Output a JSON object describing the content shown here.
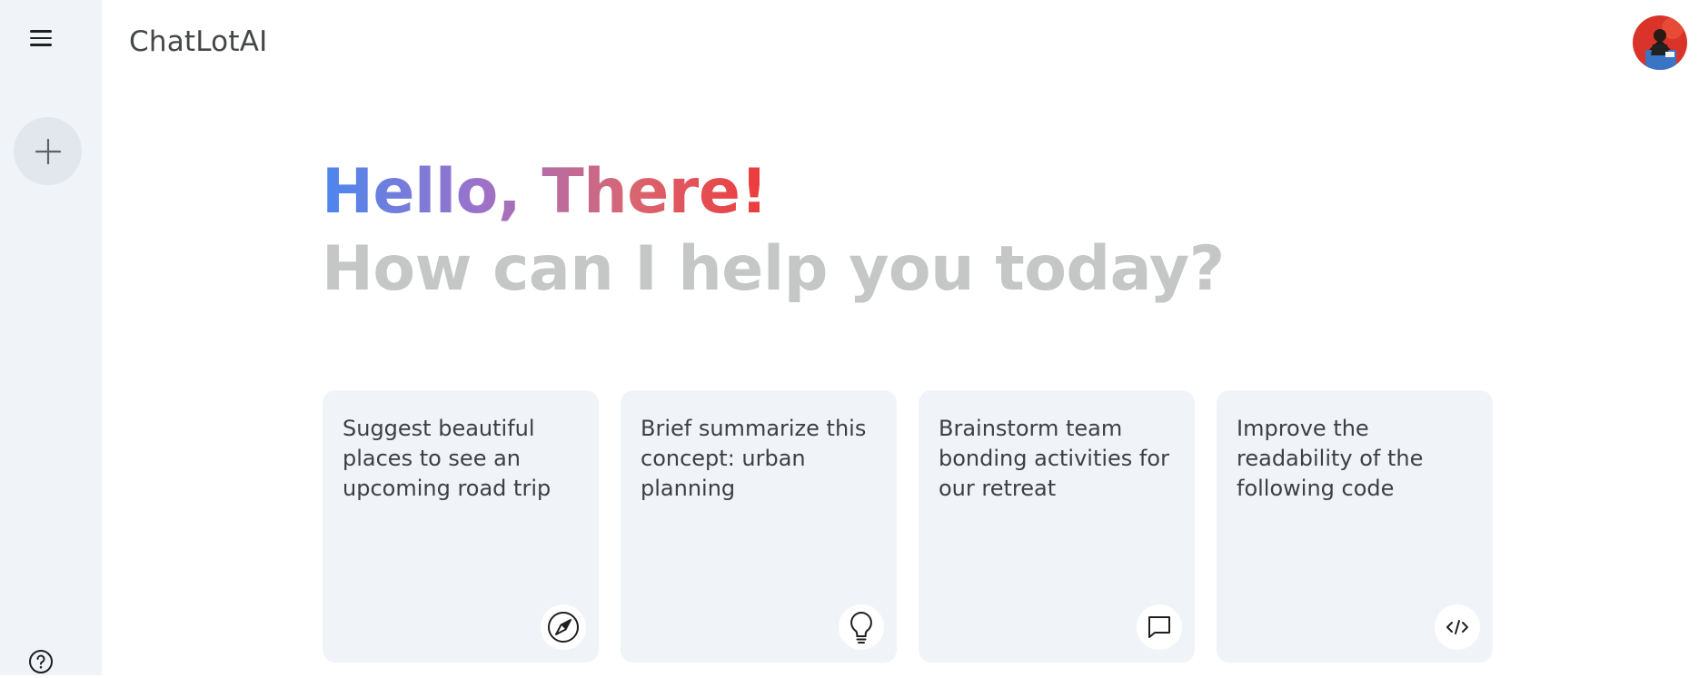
{
  "app": {
    "title": "ChatLotAI"
  },
  "greeting": {
    "hello": "Hello, There!",
    "prompt": "How can I help you today?"
  },
  "cards": [
    {
      "text": "Suggest beautiful places to see an upcoming road trip",
      "icon": "compass-icon"
    },
    {
      "text": "Brief summarize this concept: urban planning",
      "icon": "lightbulb-icon"
    },
    {
      "text": "Brainstorm team bonding activities for our retreat",
      "icon": "chat-bubble-icon"
    },
    {
      "text": "Improve the readability of the following code",
      "icon": "code-icon"
    }
  ],
  "colors": {
    "sidebar_bg": "#f0f4f9",
    "card_bg": "#f0f4f9",
    "gradient": [
      "#4b87ee",
      "#9b72cb",
      "#d96570",
      "#ee3a3a"
    ],
    "subtitle": "#c4c7c5"
  }
}
